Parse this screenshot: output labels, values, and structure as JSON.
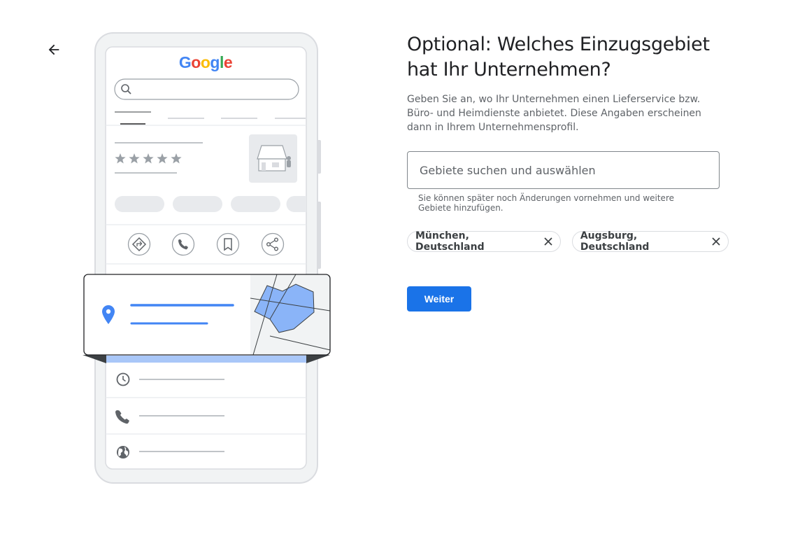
{
  "header": {
    "back_icon": "arrow-back-icon"
  },
  "illustration": {
    "logo_text": "Google",
    "logo_colors": [
      "#4285f4",
      "#ea4335",
      "#fbbc05",
      "#4285f4",
      "#34a853",
      "#ea4335"
    ],
    "rating_stars": 5,
    "accent": "#4285f4",
    "icons": [
      "search-icon",
      "store-icon",
      "directions-icon",
      "phone-icon",
      "bookmark-icon",
      "share-icon",
      "location-pin-icon",
      "map-icon",
      "clock-icon",
      "phone-icon",
      "globe-icon"
    ]
  },
  "main": {
    "title": "Optional: Welches Einzugsgebiet hat Ihr Unternehmen?",
    "description": "Geben Sie an, wo Ihr Unternehmen einen Lieferservice bzw. Büro- und Heimdienste anbietet. Diese Angaben erscheinen dann in Ihrem Unternehmensprofil.",
    "search": {
      "placeholder": "Gebiete suchen und auswählen",
      "value": ""
    },
    "hint": "Sie können später noch Änderungen vornehmen und weitere Gebiete hinzufügen.",
    "chips": [
      {
        "label": "München, Deutschland",
        "remove_icon": "close-icon"
      },
      {
        "label": "Augsburg, Deutschland",
        "remove_icon": "close-icon"
      }
    ],
    "next_button": "Weiter",
    "colors": {
      "primary": "#1a73e8",
      "text_primary": "#202124",
      "text_secondary": "#5f6368"
    }
  }
}
